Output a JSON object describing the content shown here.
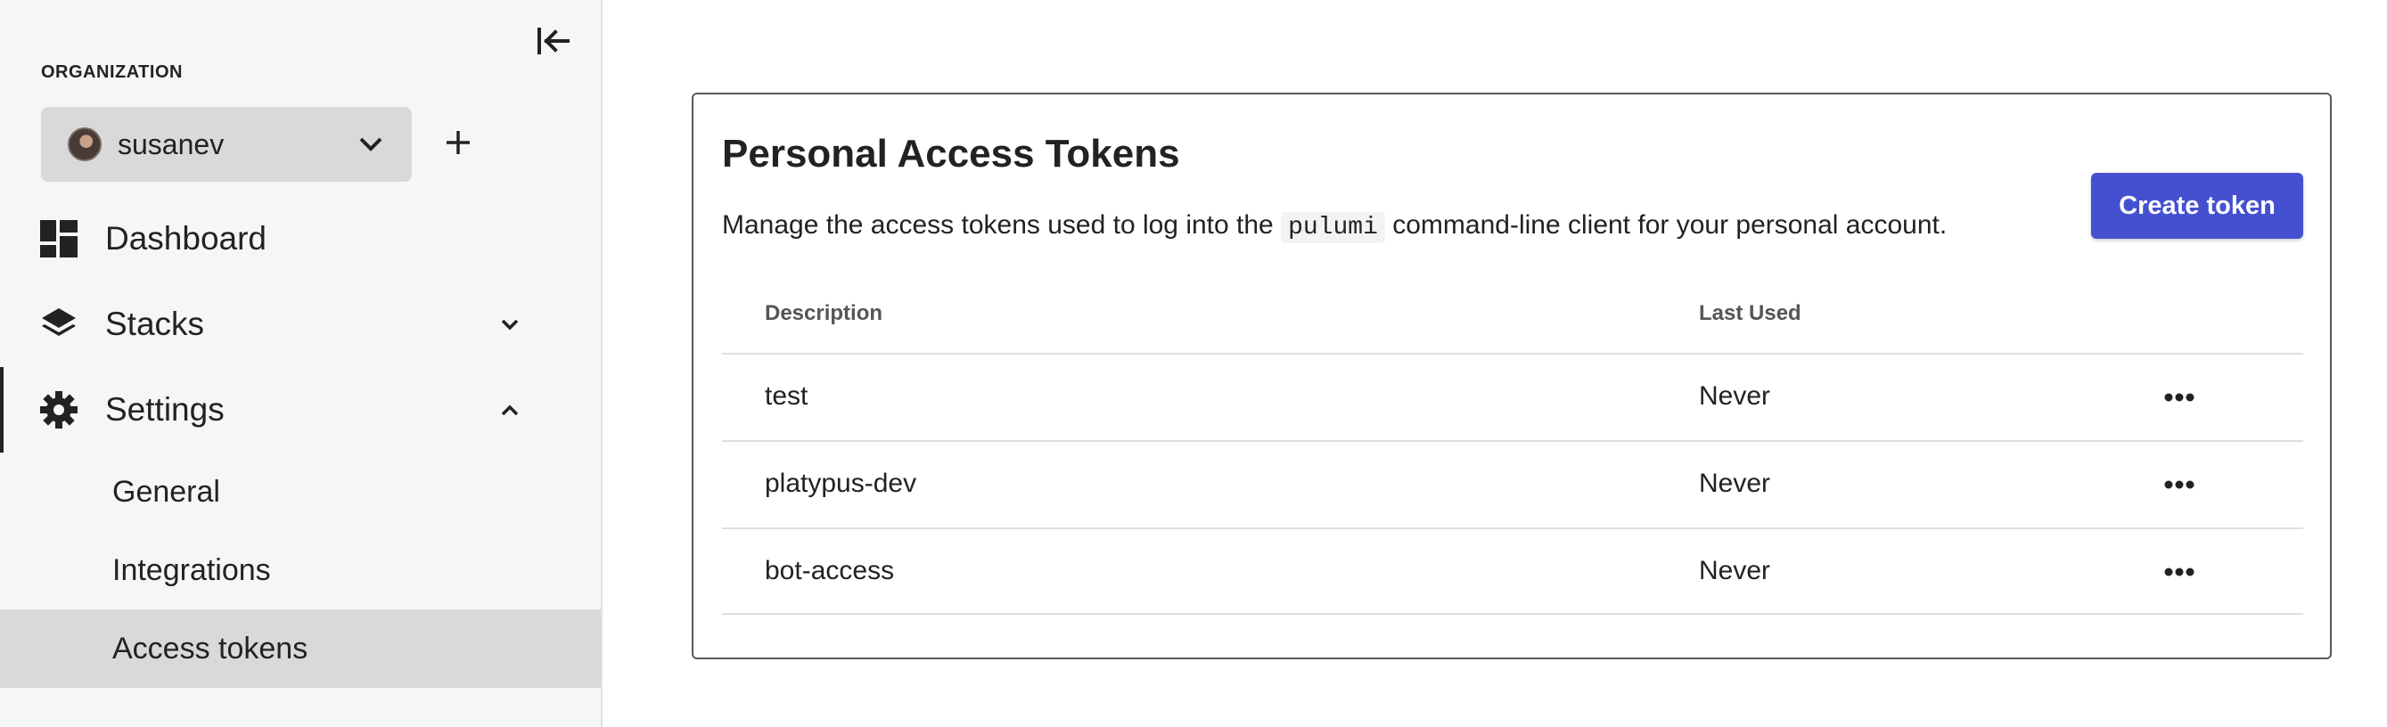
{
  "sidebar": {
    "collapse_icon": "collapse-left-icon",
    "organization_label": "ORGANIZATION",
    "organization": {
      "name": "susanev",
      "avatar_icon": "user-avatar",
      "chevron_icon": "chevron-down-icon"
    },
    "add_org_icon": "plus-icon",
    "nav": [
      {
        "label": "Dashboard",
        "icon": "dashboard-icon"
      },
      {
        "label": "Stacks",
        "icon": "layers-icon",
        "caret": "chevron-down-icon"
      },
      {
        "label": "Settings",
        "icon": "gear-icon",
        "caret": "chevron-up-icon",
        "active": true
      }
    ],
    "settings_sub": [
      {
        "label": "General"
      },
      {
        "label": "Integrations"
      },
      {
        "label": "Access tokens",
        "selected": true
      }
    ]
  },
  "main": {
    "title": "Personal Access Tokens",
    "desc_before": "Manage the access tokens used to log into the ",
    "desc_code": "pulumi",
    "desc_after": " command-line client for your personal account.",
    "create_button": "Create token",
    "table": {
      "headers": {
        "description": "Description",
        "last_used": "Last Used"
      },
      "rows": [
        {
          "description": "test",
          "last_used": "Never"
        },
        {
          "description": "platypus-dev",
          "last_used": "Never"
        },
        {
          "description": "bot-access",
          "last_used": "Never"
        }
      ]
    }
  },
  "colors": {
    "primary_button": "#4450d0",
    "sidebar_bg": "#f6f6f6",
    "selected_bg": "#d9d9d9"
  }
}
